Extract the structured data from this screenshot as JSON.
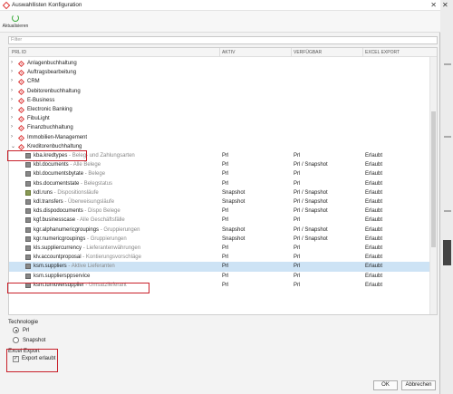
{
  "window": {
    "title": "Auswahllisten Konfiguration",
    "close_glyph": "✕"
  },
  "toolbar": {
    "refresh_label": "Aktualisieren"
  },
  "filter": {
    "placeholder": "Filter"
  },
  "columns": {
    "id": "PRL ID",
    "active": "AKTIV",
    "available": "VERFÜGBAR",
    "excel": "EXCEL EXPORT"
  },
  "folders": [
    {
      "label": "Anlagenbuchhaltung"
    },
    {
      "label": "Auftragsbearbeitung"
    },
    {
      "label": "CRM"
    },
    {
      "label": "Debitorenbuchhaltung"
    },
    {
      "label": "E-Business"
    },
    {
      "label": "Electronic Banking"
    },
    {
      "label": "FibuLight"
    },
    {
      "label": "Finanzbuchhaltung"
    },
    {
      "label": "Immobilien-Management"
    },
    {
      "label": "Kreditorenbuchhaltung",
      "expanded": true
    }
  ],
  "items": [
    {
      "id": "kba.kredtypes",
      "desc": " - Beleg- und Zahlungsarten",
      "active": "Prl",
      "available": "Prl",
      "excel": "Erlaubt",
      "icon": "table-icon"
    },
    {
      "id": "kbl.documents",
      "desc": " - Alle Belege",
      "active": "Prl",
      "available": "Prl / Snapshot",
      "excel": "Erlaubt",
      "icon": "table-icon"
    },
    {
      "id": "kbl.documentsbytate",
      "desc": " - Belege",
      "active": "Prl",
      "available": "Prl",
      "excel": "Erlaubt",
      "icon": "table-icon"
    },
    {
      "id": "kbs.documentstate",
      "desc": " - Belegstatus",
      "active": "Prl",
      "available": "Prl",
      "excel": "Erlaubt",
      "icon": "table-icon"
    },
    {
      "id": "kdl.runs",
      "desc": " - Dispositionsläufe",
      "active": "Snapshot",
      "available": "Prl / Snapshot",
      "excel": "Erlaubt",
      "icon": "snapshot-table-icon"
    },
    {
      "id": "kdl.transfers",
      "desc": " - Überweisungsläufe",
      "active": "Snapshot",
      "available": "Prl / Snapshot",
      "excel": "Erlaubt",
      "icon": "table-icon"
    },
    {
      "id": "kds.dispodocuments",
      "desc": " - Dispo Belege",
      "active": "Prl",
      "available": "Prl / Snapshot",
      "excel": "Erlaubt",
      "icon": "table-icon"
    },
    {
      "id": "kgf.businesscase",
      "desc": " - Alle Geschäftsfälle",
      "active": "Prl",
      "available": "Prl",
      "excel": "Erlaubt",
      "icon": "table-icon"
    },
    {
      "id": "kgr.alphanumericgroupings",
      "desc": " - Gruppierungen",
      "active": "Snapshot",
      "available": "Prl / Snapshot",
      "excel": "Erlaubt",
      "icon": "table-icon"
    },
    {
      "id": "kgr.numericgroupings",
      "desc": " - Gruppierungen",
      "active": "Snapshot",
      "available": "Prl / Snapshot",
      "excel": "Erlaubt",
      "icon": "table-icon"
    },
    {
      "id": "kls.suppliercurrency",
      "desc": " - Lieferantenwährungen",
      "active": "Prl",
      "available": "Prl",
      "excel": "Erlaubt",
      "icon": "table-icon"
    },
    {
      "id": "klv.accountproposal",
      "desc": " - Kontierungsvorschläge",
      "active": "Prl",
      "available": "Prl",
      "excel": "Erlaubt",
      "icon": "table-icon"
    },
    {
      "id": "ksm.suppliers",
      "desc": " - Aktive Lieferanten",
      "active": "Prl",
      "available": "Prl",
      "excel": "Erlaubt",
      "icon": "table-icon",
      "selected": true
    },
    {
      "id": "ksm.suppliersppservice",
      "desc": "",
      "active": "Prl",
      "available": "Prl",
      "excel": "Erlaubt",
      "icon": "table-icon"
    },
    {
      "id": "ksm.turnoversupplier",
      "desc": " - Umsatzlieferant",
      "active": "Prl",
      "available": "Prl",
      "excel": "Erlaubt",
      "icon": "table-icon"
    }
  ],
  "technology": {
    "heading": "Technologie",
    "options": [
      "Prl",
      "Snapshot"
    ],
    "selected": "Prl"
  },
  "excel_export": {
    "heading": "Excel Export",
    "checkbox_label": "Export erlaubt",
    "checked": true
  },
  "buttons": {
    "ok": "OK",
    "cancel": "Abbrechen"
  },
  "colors": {
    "highlight": "#c8202a",
    "selected_row": "#cde3f5",
    "accent_red": "#d33"
  }
}
